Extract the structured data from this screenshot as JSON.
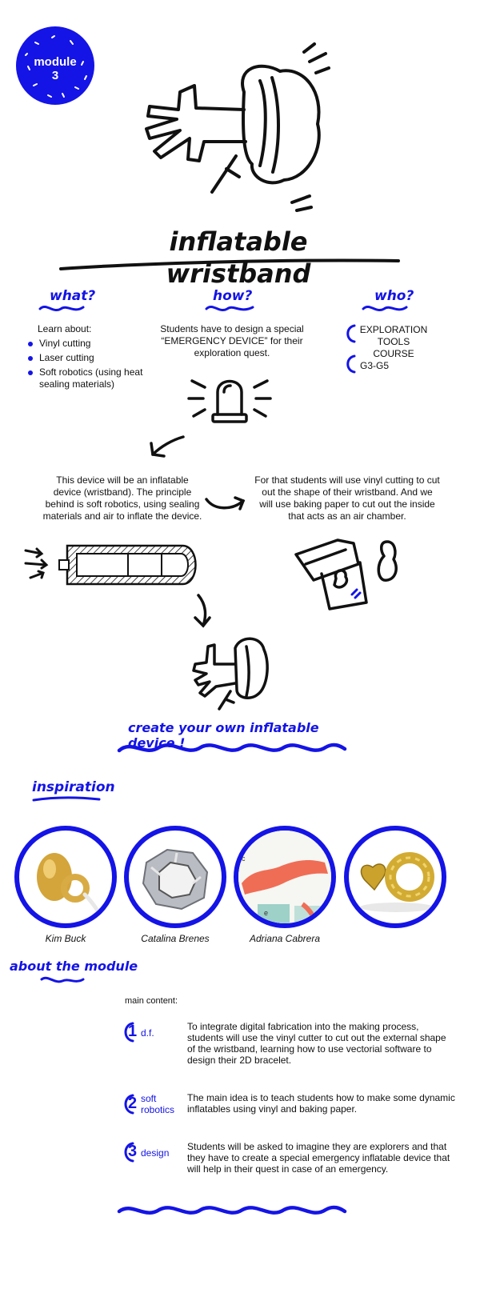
{
  "badge": {
    "line1": "module",
    "line2": "3"
  },
  "title": "inflatable wristband",
  "columns": {
    "what": {
      "heading": "what?",
      "intro": "Learn about:",
      "items": [
        "Vinyl cutting",
        "Laser cutting",
        "Soft robotics (using heat sealing materials)"
      ]
    },
    "how": {
      "heading": "how?",
      "text": "Students have to design a special “EMERGENCY DEVICE” for their exploration quest."
    },
    "who": {
      "heading": "who?",
      "items": [
        "EXPLORATION TOOLS COURSE",
        "G3-G5"
      ]
    }
  },
  "process": {
    "left_text": "This device will be an inflatable device (wristband). The principle behind is soft robotics, using sealing materials and air to inflate the device.",
    "right_text": "For that students will use vinyl cutting to cut out the shape of their wristband. And we will use baking paper to cut out the inside that acts as an air chamber."
  },
  "cta": "create your own inflatable device !",
  "inspiration": {
    "heading": "inspiration",
    "items": [
      {
        "caption": "Kim Buck"
      },
      {
        "caption": "Catalina Brenes"
      },
      {
        "caption": "Adriana Cabrera"
      },
      {
        "caption": ""
      }
    ],
    "photo3_letters": {
      "a": "c",
      "b": "e"
    }
  },
  "about": {
    "heading": "about the module",
    "subheading": "main content:",
    "items": [
      {
        "num": "1",
        "label": "d.f.",
        "text": "To integrate digital fabrication into the making process, students will use the vinyl cutter to cut out the external shape of the wristband, learning how to use vectorial software to design their 2D bracelet."
      },
      {
        "num": "2",
        "label": "soft robotics",
        "text": "The main idea is to teach students how to make some dynamic inflatables using vinyl and baking paper."
      },
      {
        "num": "3",
        "label": "design",
        "text": "Students will be asked to imagine they are explorers and that they have to create a special emergency inflatable device that will help in their quest in case of an emergency."
      }
    ]
  },
  "colors": {
    "accent": "#1414e6",
    "ink": "#111111"
  }
}
